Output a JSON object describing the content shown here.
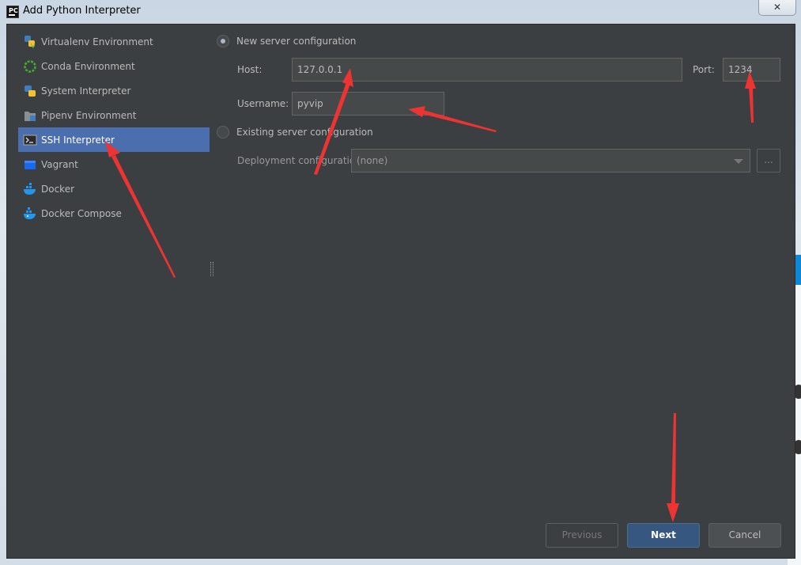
{
  "window": {
    "title": "Add Python Interpreter",
    "app_icon_text": "PC",
    "close_glyph": "✕"
  },
  "sidebar": {
    "items": [
      {
        "label": "Virtualenv Environment",
        "icon": "virtualenv-icon",
        "selected": false
      },
      {
        "label": "Conda Environment",
        "icon": "conda-icon",
        "selected": false
      },
      {
        "label": "System Interpreter",
        "icon": "python-icon",
        "selected": false
      },
      {
        "label": "Pipenv Environment",
        "icon": "pipenv-icon",
        "selected": false
      },
      {
        "label": "SSH Interpreter",
        "icon": "terminal-icon",
        "selected": true
      },
      {
        "label": "Vagrant",
        "icon": "vagrant-icon",
        "selected": false
      },
      {
        "label": "Docker",
        "icon": "docker-icon",
        "selected": false
      },
      {
        "label": "Docker Compose",
        "icon": "docker-compose-icon",
        "selected": false
      }
    ]
  },
  "form": {
    "new_server": {
      "label": "New server configuration",
      "selected": true,
      "host_label": "Host:",
      "host_value": "127.0.0.1",
      "port_label": "Port:",
      "port_value": "1234",
      "username_label": "Username:",
      "username_value": "pyvip"
    },
    "existing_server": {
      "label": "Existing server configuration",
      "selected": false,
      "deployment_label": "Deployment configuration:",
      "deployment_value": "(none)",
      "more_label": "..."
    }
  },
  "buttons": {
    "previous": "Previous",
    "next": "Next",
    "cancel": "Cancel"
  },
  "colors": {
    "dialog_bg": "#3c3f41",
    "selection": "#4b6eaf",
    "primary_button": "#365880",
    "annotation_arrow": "#ee3333"
  }
}
